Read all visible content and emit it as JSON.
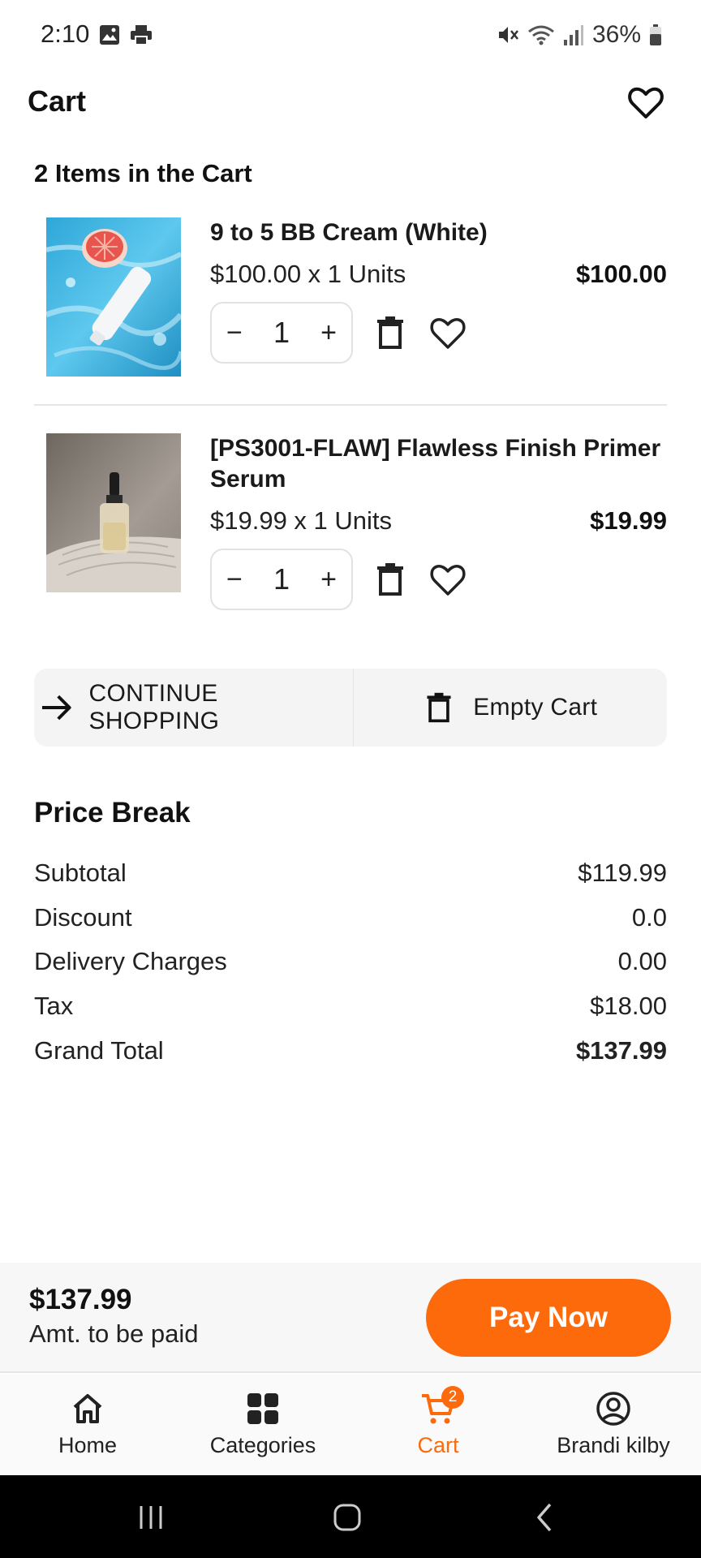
{
  "status_bar": {
    "time": "2:10",
    "battery": "36%",
    "icons": [
      "image-icon",
      "printer-icon",
      "mute-icon",
      "wifi-icon",
      "signal-icon",
      "battery-icon"
    ]
  },
  "app_bar": {
    "title": "Cart",
    "favorite_icon": "heart-icon"
  },
  "cart": {
    "count_label": "2 Items in the Cart",
    "items": [
      {
        "title": "9 to 5 BB Cream (White)",
        "unit_price": "$100.00 x 1 Units",
        "total": "$100.00",
        "quantity": "1",
        "minus": "−",
        "plus": "+"
      },
      {
        "title": "[PS3001-FLAW] Flawless Finish Primer Serum",
        "unit_price": "$19.99 x 1 Units",
        "total": "$19.99",
        "quantity": "1",
        "minus": "−",
        "plus": "+"
      }
    ]
  },
  "actions": {
    "continue_shopping": "CONTINUE SHOPPING",
    "empty_cart": "Empty Cart"
  },
  "price_break": {
    "title": "Price Break",
    "rows": [
      {
        "label": "Subtotal",
        "value": "$119.99"
      },
      {
        "label": "Discount",
        "value": "0.0"
      },
      {
        "label": "Delivery Charges",
        "value": "0.00"
      },
      {
        "label": "Tax",
        "value": "$18.00"
      },
      {
        "label": "Grand Total",
        "value": "$137.99"
      }
    ]
  },
  "pay_bar": {
    "amount": "$137.99",
    "amount_label": "Amt. to be paid",
    "pay_button": "Pay Now"
  },
  "bottom_nav": {
    "items": [
      {
        "label": "Home",
        "icon": "home-icon"
      },
      {
        "label": "Categories",
        "icon": "categories-icon"
      },
      {
        "label": "Cart",
        "icon": "cart-icon",
        "badge": "2",
        "active": true
      },
      {
        "label": "Brandi kilby",
        "icon": "account-icon"
      }
    ]
  },
  "colors": {
    "accent": "#fc6a0c",
    "text": "#111111",
    "surface": "#f4f4f4"
  }
}
